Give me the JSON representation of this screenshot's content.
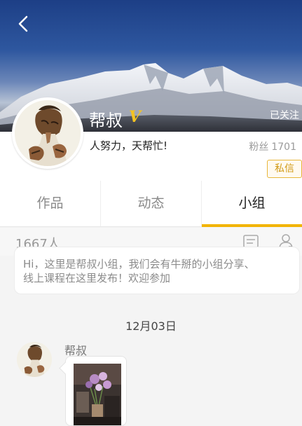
{
  "header": {
    "back_icon": "back-arrow-icon",
    "follow_status": "已关注"
  },
  "profile": {
    "name": "帮叔",
    "verified_badge": "V",
    "bio": "人努力，天帮忙!",
    "followers_label": "粉丝",
    "followers_count": "1701",
    "message_button": "私信"
  },
  "tabs": [
    {
      "label": "作品",
      "active": false
    },
    {
      "label": "动态",
      "active": false
    },
    {
      "label": "小组",
      "active": true
    }
  ],
  "group": {
    "member_count": "1667人",
    "notice_icon": "notice-board-icon",
    "members_icon": "member-profile-icon",
    "announcement_line1": "Hi，这里是帮叔小组，我们会有牛掰的小组分享、",
    "announcement_line2": "线上课程在这里发布！欢迎参加"
  },
  "chat": {
    "date": "12月03日",
    "sender": "帮叔"
  },
  "colors": {
    "accent": "#f2b400",
    "badge": "#f3c322"
  }
}
